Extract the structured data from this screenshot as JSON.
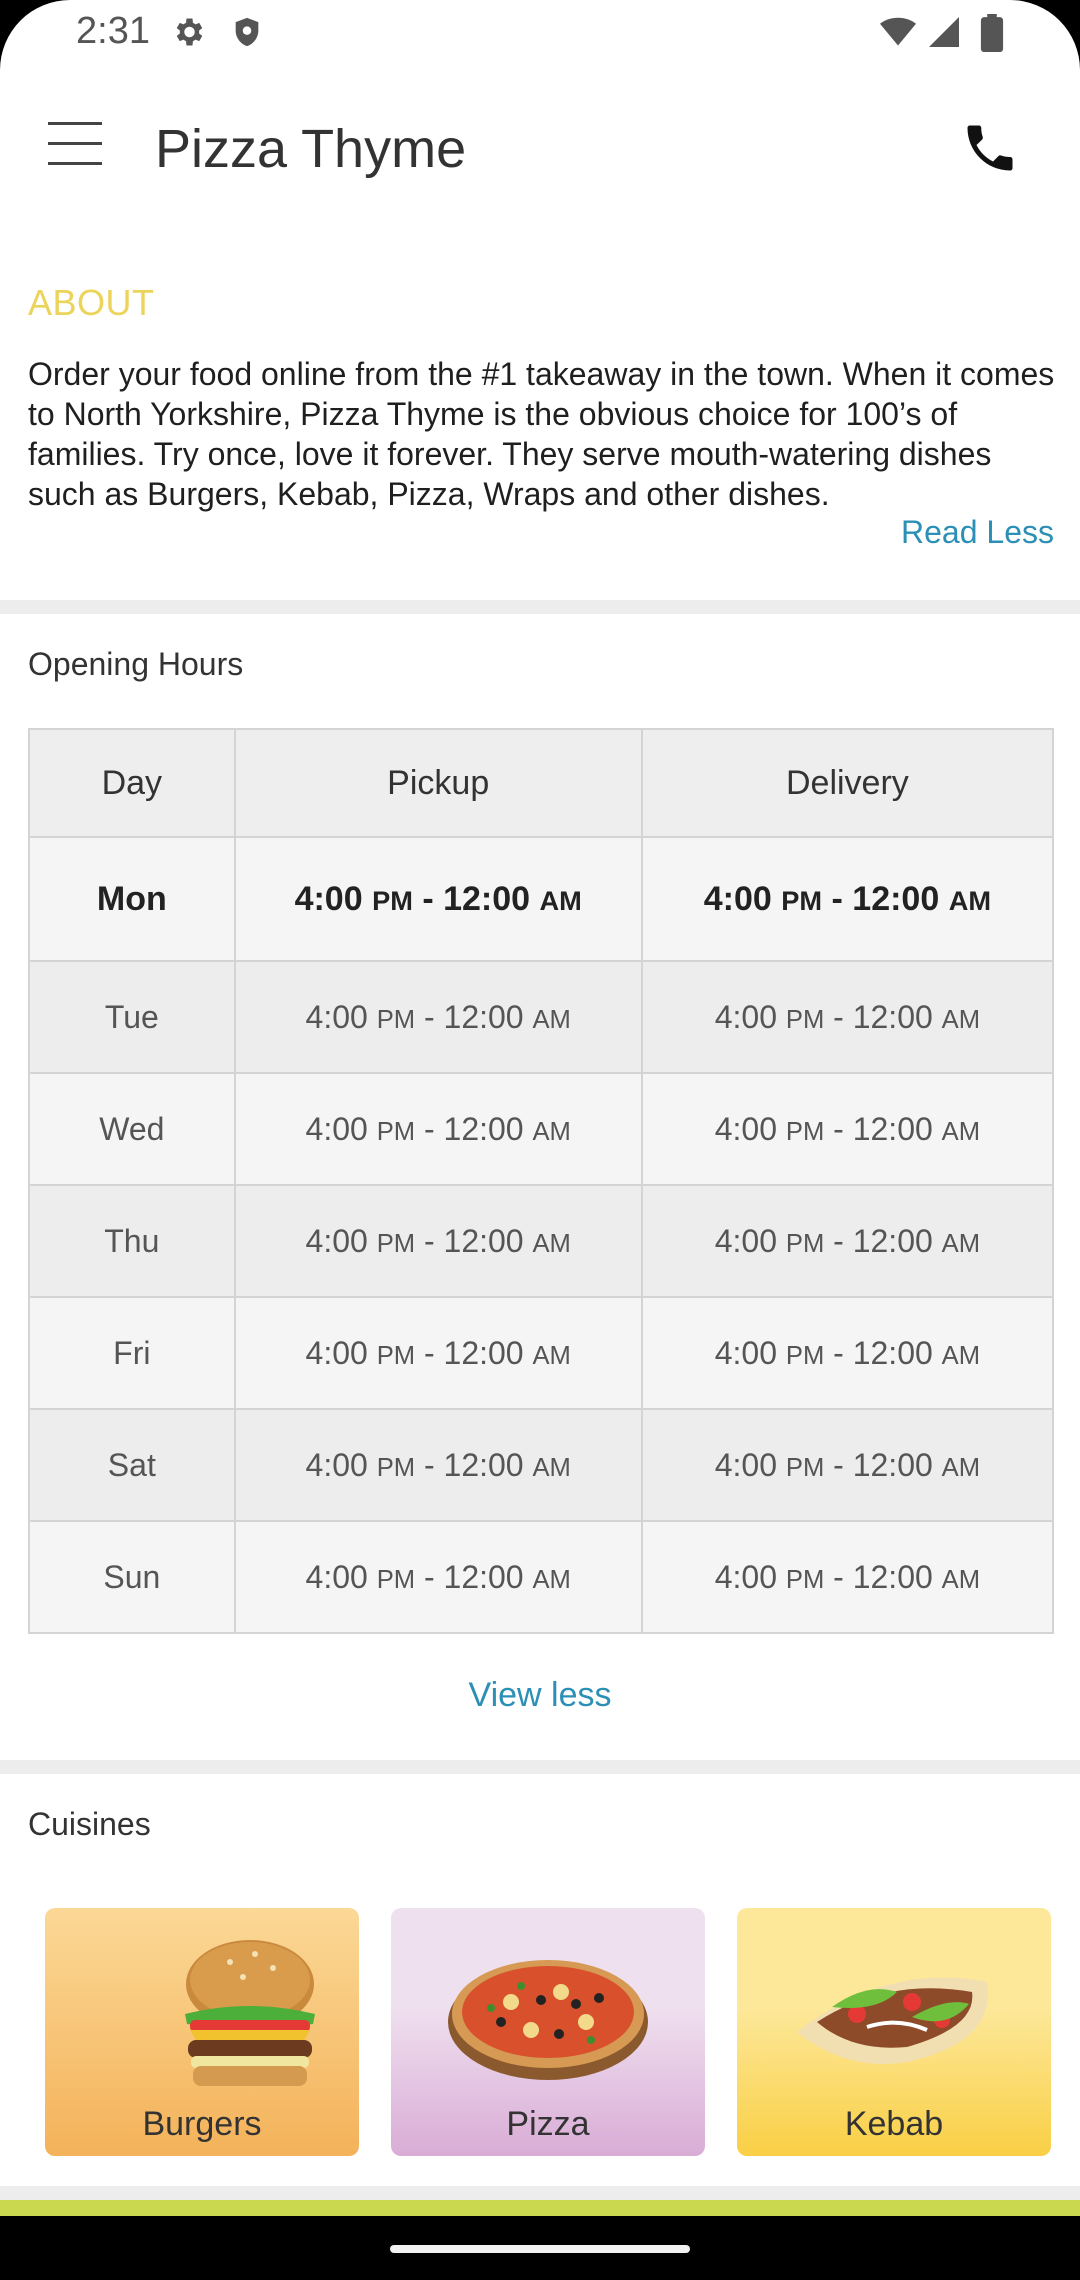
{
  "status_bar": {
    "time": "2:31",
    "left_icons": [
      "settings-icon",
      "shield-icon"
    ],
    "right_icons": [
      "wifi-icon",
      "signal-icon",
      "battery-icon"
    ]
  },
  "app_bar": {
    "title": "Pizza Thyme",
    "menu_icon": "hamburger-menu-icon",
    "call_icon": "phone-icon"
  },
  "about": {
    "heading": "ABOUT",
    "text": "Order your food online from the #1 takeaway in the town. When it comes to North Yorkshire, Pizza Thyme is the obvious choice for 100’s of families. Try once, love it forever. They serve mouth-watering dishes such as Burgers, Kebab, Pizza, Wraps and other dishes.",
    "toggle_label": "Read Less"
  },
  "opening_hours": {
    "title": "Opening Hours",
    "headers": [
      "Day",
      "Pickup",
      "Delivery"
    ],
    "rows": [
      {
        "day": "Mon",
        "pickup_open": "4:00",
        "pickup_open_period": "PM",
        "pickup_close": "12:00",
        "pickup_close_period": "AM",
        "delivery_open": "4:00",
        "delivery_open_period": "PM",
        "delivery_close": "12:00",
        "delivery_close_period": "AM"
      },
      {
        "day": "Tue",
        "pickup_open": "4:00",
        "pickup_open_period": "PM",
        "pickup_close": "12:00",
        "pickup_close_period": "AM",
        "delivery_open": "4:00",
        "delivery_open_period": "PM",
        "delivery_close": "12:00",
        "delivery_close_period": "AM"
      },
      {
        "day": "Wed",
        "pickup_open": "4:00",
        "pickup_open_period": "PM",
        "pickup_close": "12:00",
        "pickup_close_period": "AM",
        "delivery_open": "4:00",
        "delivery_open_period": "PM",
        "delivery_close": "12:00",
        "delivery_close_period": "AM"
      },
      {
        "day": "Thu",
        "pickup_open": "4:00",
        "pickup_open_period": "PM",
        "pickup_close": "12:00",
        "pickup_close_period": "AM",
        "delivery_open": "4:00",
        "delivery_open_period": "PM",
        "delivery_close": "12:00",
        "delivery_close_period": "AM"
      },
      {
        "day": "Fri",
        "pickup_open": "4:00",
        "pickup_open_period": "PM",
        "pickup_close": "12:00",
        "pickup_close_period": "AM",
        "delivery_open": "4:00",
        "delivery_open_period": "PM",
        "delivery_close": "12:00",
        "delivery_close_period": "AM"
      },
      {
        "day": "Sat",
        "pickup_open": "4:00",
        "pickup_open_period": "PM",
        "pickup_close": "12:00",
        "pickup_close_period": "AM",
        "delivery_open": "4:00",
        "delivery_open_period": "PM",
        "delivery_close": "12:00",
        "delivery_close_period": "AM"
      },
      {
        "day": "Sun",
        "pickup_open": "4:00",
        "pickup_open_period": "PM",
        "pickup_close": "12:00",
        "pickup_close_period": "AM",
        "delivery_open": "4:00",
        "delivery_open_period": "PM",
        "delivery_close": "12:00",
        "delivery_close_period": "AM"
      }
    ],
    "toggle_label": "View less"
  },
  "cuisines": {
    "title": "Cuisines",
    "items": [
      {
        "label": "Burgers",
        "icon": "burger-image",
        "color_top": "#fbd896",
        "color_bottom": "#f4b25a"
      },
      {
        "label": "Pizza",
        "icon": "pizza-image",
        "color_top": "#efe0ef",
        "color_bottom": "#d9acd6"
      },
      {
        "label": "Kebab",
        "icon": "kebab-image",
        "color_top": "#fde89a",
        "color_bottom": "#f9cf45"
      }
    ]
  },
  "colors": {
    "accent_link": "#2b8fb6",
    "about_heading": "#ecd35a",
    "bottom_strip": "#c9d84e"
  }
}
